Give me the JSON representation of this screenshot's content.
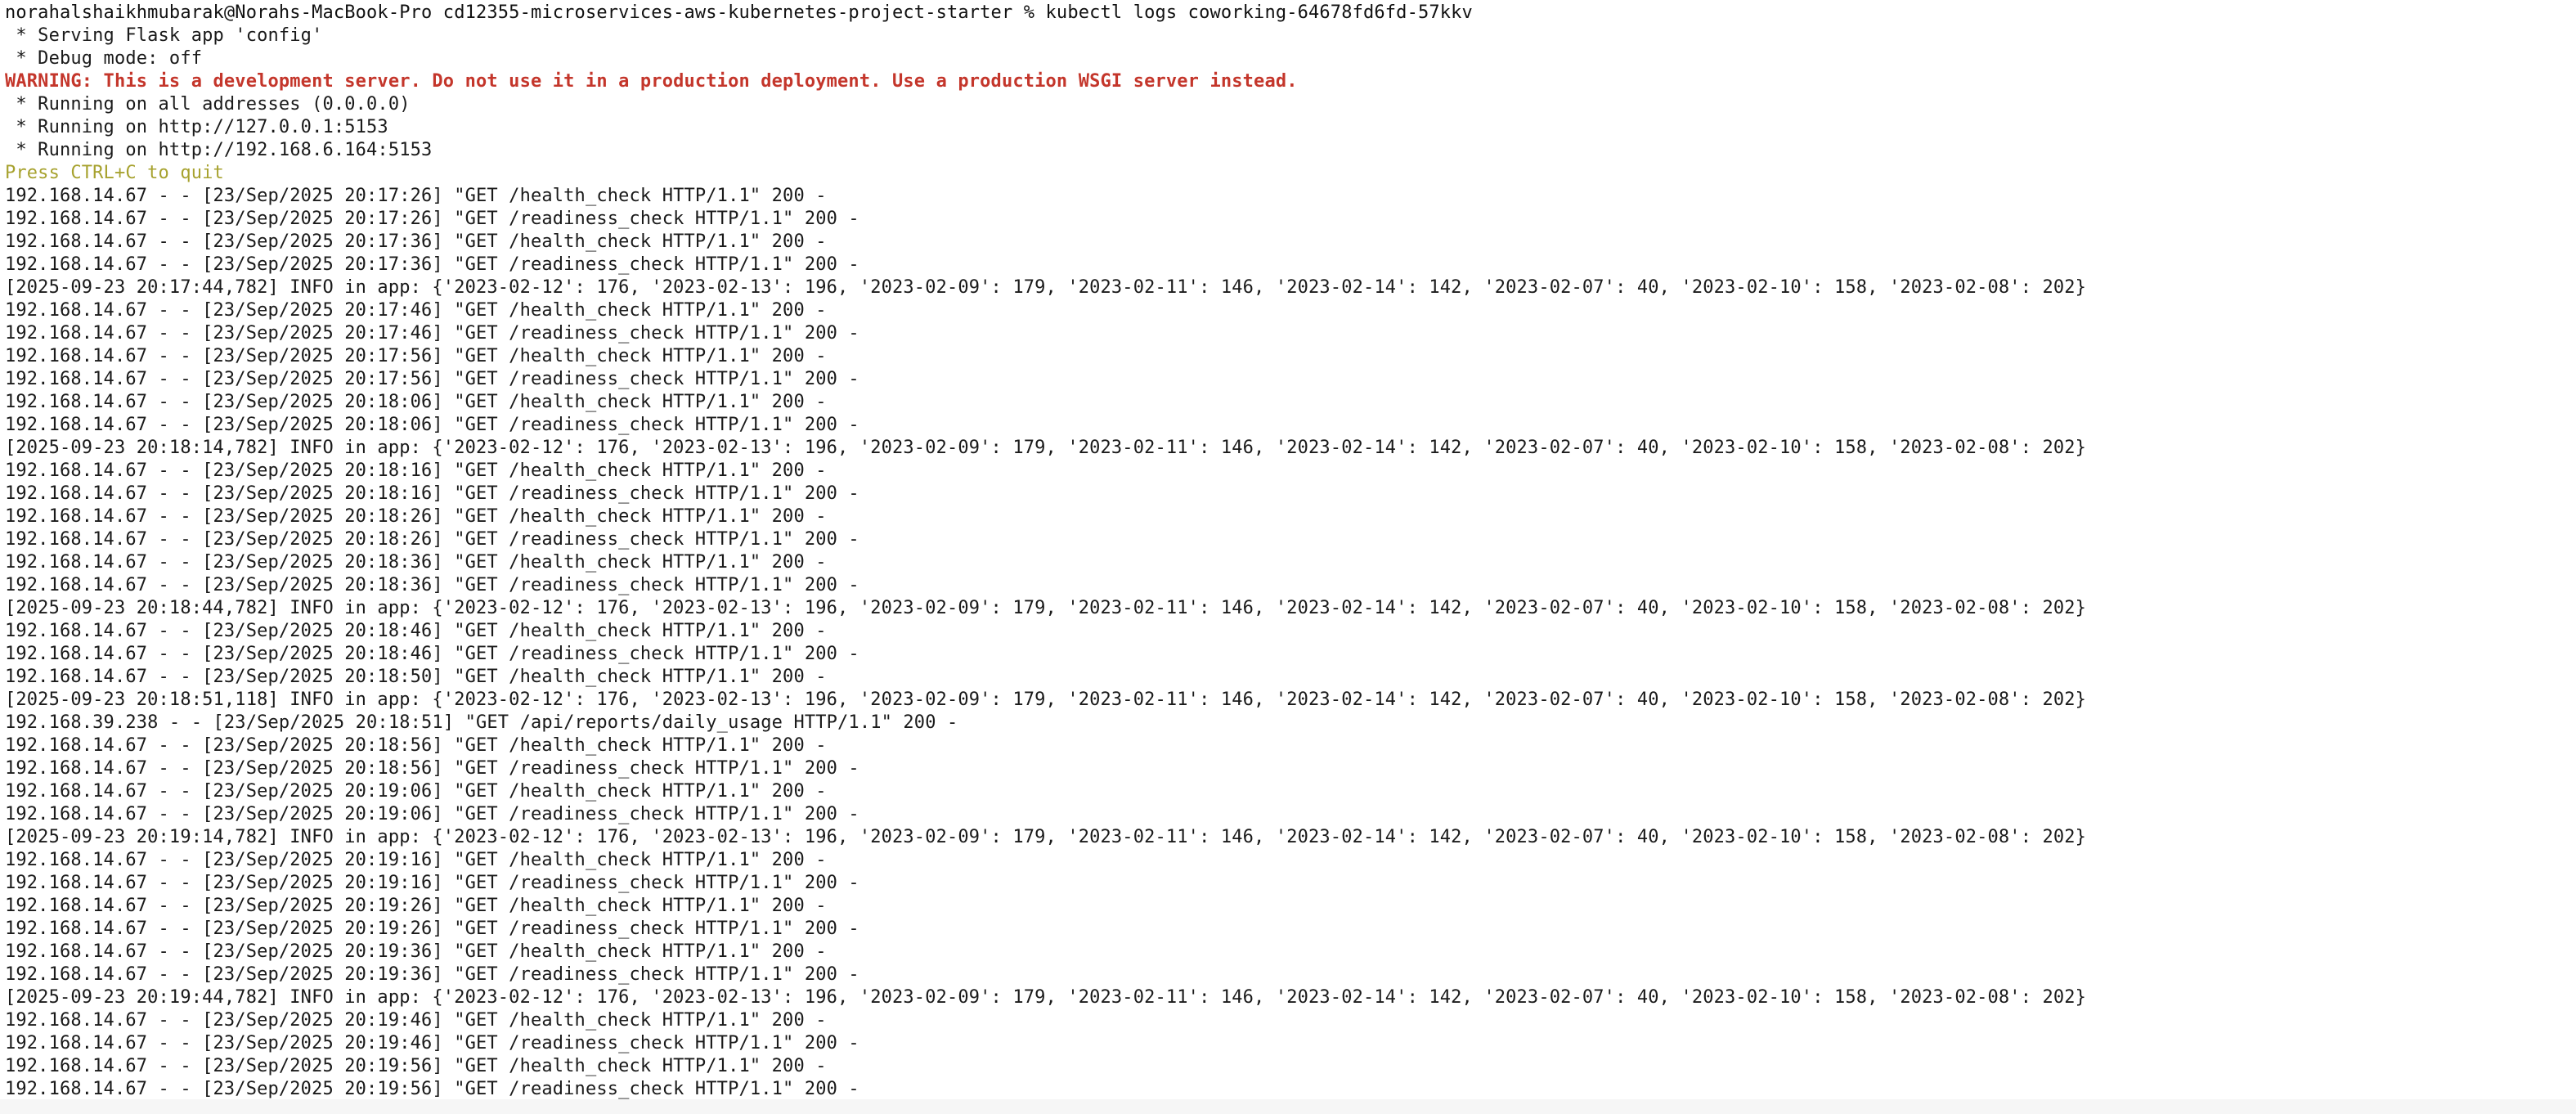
{
  "terminal": {
    "command": "norahalshaikhmubarak@Norahs-MacBook-Pro cd12355-microservices-aws-kubernetes-project-starter % kubectl logs coworking-64678fd6fd-57kkv",
    "lines": [
      {
        "kind": "plain",
        "text": " * Serving Flask app 'config'"
      },
      {
        "kind": "plain",
        "text": " * Debug mode: off"
      },
      {
        "kind": "warning",
        "text": "WARNING: This is a development server. Do not use it in a production deployment. Use a production WSGI server instead."
      },
      {
        "kind": "plain",
        "text": " * Running on all addresses (0.0.0.0)"
      },
      {
        "kind": "plain",
        "text": " * Running on http://127.0.0.1:5153"
      },
      {
        "kind": "plain",
        "text": " * Running on http://192.168.6.164:5153"
      },
      {
        "kind": "hint",
        "text": "Press CTRL+C to quit"
      },
      {
        "kind": "access",
        "text": "192.168.14.67 - - [23/Sep/2025 20:17:26] \"GET /health_check HTTP/1.1\" 200 -"
      },
      {
        "kind": "access",
        "text": "192.168.14.67 - - [23/Sep/2025 20:17:26] \"GET /readiness_check HTTP/1.1\" 200 -"
      },
      {
        "kind": "access",
        "text": "192.168.14.67 - - [23/Sep/2025 20:17:36] \"GET /health_check HTTP/1.1\" 200 -"
      },
      {
        "kind": "access",
        "text": "192.168.14.67 - - [23/Sep/2025 20:17:36] \"GET /readiness_check HTTP/1.1\" 200 -"
      },
      {
        "kind": "info",
        "text": "[2025-09-23 20:17:44,782] INFO in app: {'2023-02-12': 176, '2023-02-13': 196, '2023-02-09': 179, '2023-02-11': 146, '2023-02-14': 142, '2023-02-07': 40, '2023-02-10': 158, '2023-02-08': 202}"
      },
      {
        "kind": "access",
        "text": "192.168.14.67 - - [23/Sep/2025 20:17:46] \"GET /health_check HTTP/1.1\" 200 -"
      },
      {
        "kind": "access",
        "text": "192.168.14.67 - - [23/Sep/2025 20:17:46] \"GET /readiness_check HTTP/1.1\" 200 -"
      },
      {
        "kind": "access",
        "text": "192.168.14.67 - - [23/Sep/2025 20:17:56] \"GET /health_check HTTP/1.1\" 200 -"
      },
      {
        "kind": "access",
        "text": "192.168.14.67 - - [23/Sep/2025 20:17:56] \"GET /readiness_check HTTP/1.1\" 200 -"
      },
      {
        "kind": "access",
        "text": "192.168.14.67 - - [23/Sep/2025 20:18:06] \"GET /health_check HTTP/1.1\" 200 -"
      },
      {
        "kind": "access",
        "text": "192.168.14.67 - - [23/Sep/2025 20:18:06] \"GET /readiness_check HTTP/1.1\" 200 -"
      },
      {
        "kind": "info",
        "text": "[2025-09-23 20:18:14,782] INFO in app: {'2023-02-12': 176, '2023-02-13': 196, '2023-02-09': 179, '2023-02-11': 146, '2023-02-14': 142, '2023-02-07': 40, '2023-02-10': 158, '2023-02-08': 202}"
      },
      {
        "kind": "access",
        "text": "192.168.14.67 - - [23/Sep/2025 20:18:16] \"GET /health_check HTTP/1.1\" 200 -"
      },
      {
        "kind": "access",
        "text": "192.168.14.67 - - [23/Sep/2025 20:18:16] \"GET /readiness_check HTTP/1.1\" 200 -"
      },
      {
        "kind": "access",
        "text": "192.168.14.67 - - [23/Sep/2025 20:18:26] \"GET /health_check HTTP/1.1\" 200 -"
      },
      {
        "kind": "access",
        "text": "192.168.14.67 - - [23/Sep/2025 20:18:26] \"GET /readiness_check HTTP/1.1\" 200 -"
      },
      {
        "kind": "access",
        "text": "192.168.14.67 - - [23/Sep/2025 20:18:36] \"GET /health_check HTTP/1.1\" 200 -"
      },
      {
        "kind": "access",
        "text": "192.168.14.67 - - [23/Sep/2025 20:18:36] \"GET /readiness_check HTTP/1.1\" 200 -"
      },
      {
        "kind": "info",
        "text": "[2025-09-23 20:18:44,782] INFO in app: {'2023-02-12': 176, '2023-02-13': 196, '2023-02-09': 179, '2023-02-11': 146, '2023-02-14': 142, '2023-02-07': 40, '2023-02-10': 158, '2023-02-08': 202}"
      },
      {
        "kind": "access",
        "text": "192.168.14.67 - - [23/Sep/2025 20:18:46] \"GET /health_check HTTP/1.1\" 200 -"
      },
      {
        "kind": "access",
        "text": "192.168.14.67 - - [23/Sep/2025 20:18:46] \"GET /readiness_check HTTP/1.1\" 200 -"
      },
      {
        "kind": "access",
        "text": "192.168.14.67 - - [23/Sep/2025 20:18:50] \"GET /health_check HTTP/1.1\" 200 -"
      },
      {
        "kind": "info",
        "text": "[2025-09-23 20:18:51,118] INFO in app: {'2023-02-12': 176, '2023-02-13': 196, '2023-02-09': 179, '2023-02-11': 146, '2023-02-14': 142, '2023-02-07': 40, '2023-02-10': 158, '2023-02-08': 202}"
      },
      {
        "kind": "access",
        "text": "192.168.39.238 - - [23/Sep/2025 20:18:51] \"GET /api/reports/daily_usage HTTP/1.1\" 200 -"
      },
      {
        "kind": "access",
        "text": "192.168.14.67 - - [23/Sep/2025 20:18:56] \"GET /health_check HTTP/1.1\" 200 -"
      },
      {
        "kind": "access",
        "text": "192.168.14.67 - - [23/Sep/2025 20:18:56] \"GET /readiness_check HTTP/1.1\" 200 -"
      },
      {
        "kind": "access",
        "text": "192.168.14.67 - - [23/Sep/2025 20:19:06] \"GET /health_check HTTP/1.1\" 200 -"
      },
      {
        "kind": "access",
        "text": "192.168.14.67 - - [23/Sep/2025 20:19:06] \"GET /readiness_check HTTP/1.1\" 200 -"
      },
      {
        "kind": "info",
        "text": "[2025-09-23 20:19:14,782] INFO in app: {'2023-02-12': 176, '2023-02-13': 196, '2023-02-09': 179, '2023-02-11': 146, '2023-02-14': 142, '2023-02-07': 40, '2023-02-10': 158, '2023-02-08': 202}"
      },
      {
        "kind": "access",
        "text": "192.168.14.67 - - [23/Sep/2025 20:19:16] \"GET /health_check HTTP/1.1\" 200 -"
      },
      {
        "kind": "access",
        "text": "192.168.14.67 - - [23/Sep/2025 20:19:16] \"GET /readiness_check HTTP/1.1\" 200 -"
      },
      {
        "kind": "access",
        "text": "192.168.14.67 - - [23/Sep/2025 20:19:26] \"GET /health_check HTTP/1.1\" 200 -"
      },
      {
        "kind": "access",
        "text": "192.168.14.67 - - [23/Sep/2025 20:19:26] \"GET /readiness_check HTTP/1.1\" 200 -"
      },
      {
        "kind": "access",
        "text": "192.168.14.67 - - [23/Sep/2025 20:19:36] \"GET /health_check HTTP/1.1\" 200 -"
      },
      {
        "kind": "access",
        "text": "192.168.14.67 - - [23/Sep/2025 20:19:36] \"GET /readiness_check HTTP/1.1\" 200 -"
      },
      {
        "kind": "info",
        "text": "[2025-09-23 20:19:44,782] INFO in app: {'2023-02-12': 176, '2023-02-13': 196, '2023-02-09': 179, '2023-02-11': 146, '2023-02-14': 142, '2023-02-07': 40, '2023-02-10': 158, '2023-02-08': 202}"
      },
      {
        "kind": "access",
        "text": "192.168.14.67 - - [23/Sep/2025 20:19:46] \"GET /health_check HTTP/1.1\" 200 -"
      },
      {
        "kind": "access",
        "text": "192.168.14.67 - - [23/Sep/2025 20:19:46] \"GET /readiness_check HTTP/1.1\" 200 -"
      },
      {
        "kind": "access",
        "text": "192.168.14.67 - - [23/Sep/2025 20:19:56] \"GET /health_check HTTP/1.1\" 200 -"
      },
      {
        "kind": "access",
        "text": "192.168.14.67 - - [23/Sep/2025 20:19:56] \"GET /readiness_check HTTP/1.1\" 200 -"
      }
    ]
  },
  "colors": {
    "background": "#ffffff",
    "text": "#1a1a1a",
    "warning": "#c4362b",
    "hint": "#a7a22f"
  }
}
